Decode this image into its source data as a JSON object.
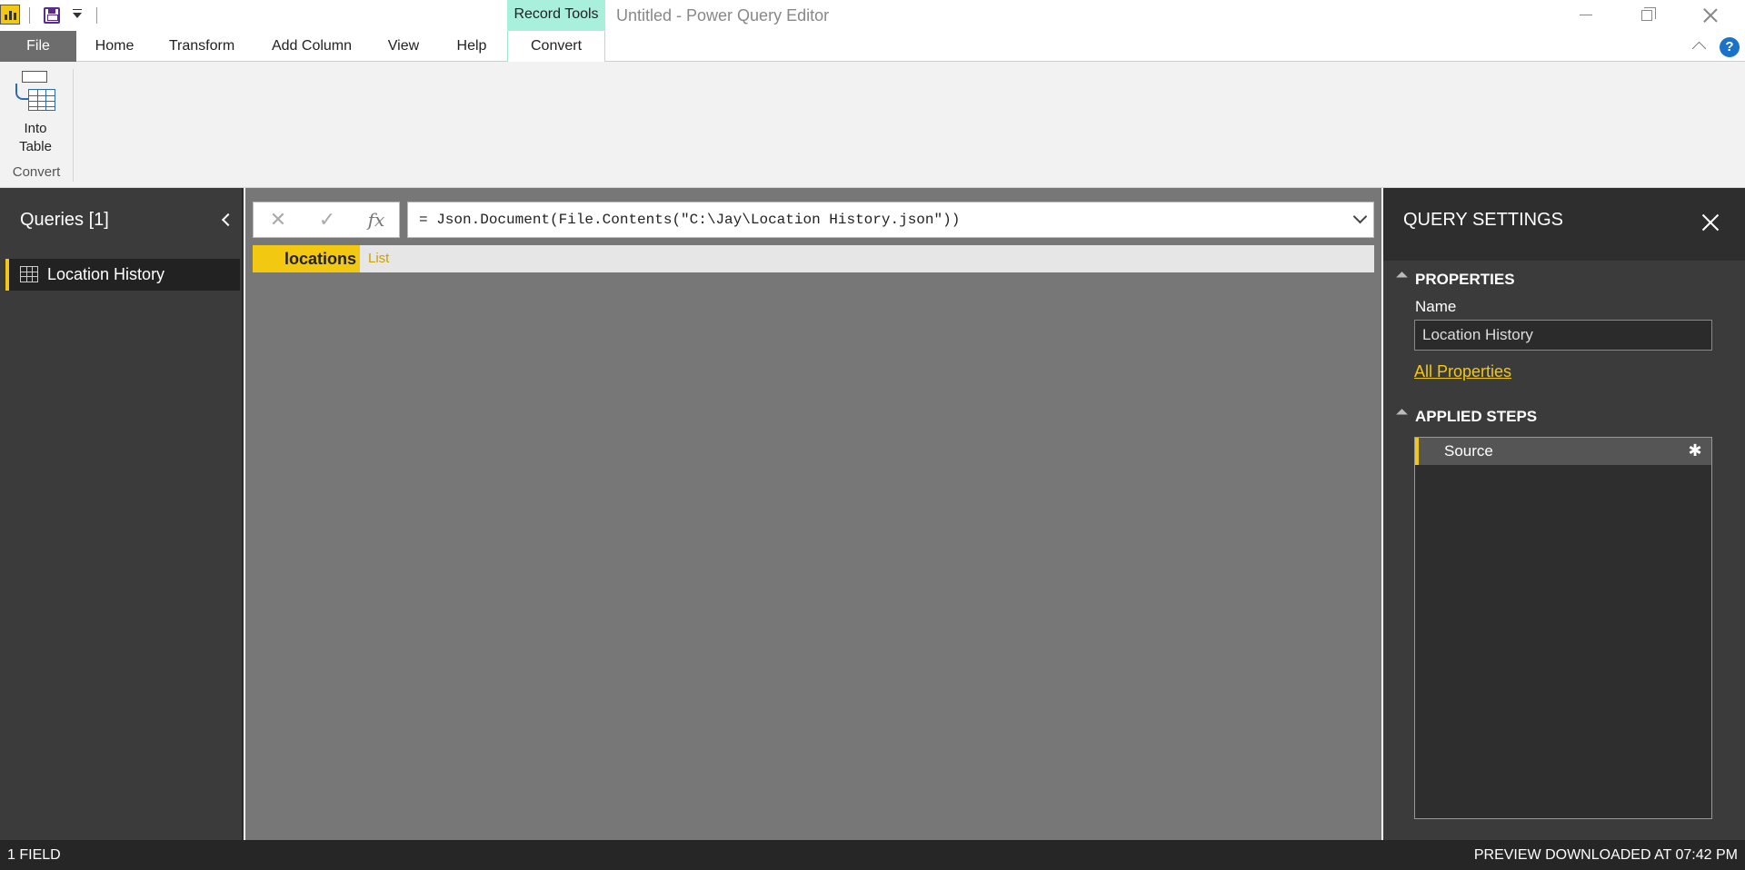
{
  "window": {
    "context_group": "Record Tools",
    "title": "Untitled - Power Query Editor"
  },
  "tabs": [
    {
      "label": "File"
    },
    {
      "label": "Home"
    },
    {
      "label": "Transform"
    },
    {
      "label": "Add Column"
    },
    {
      "label": "View"
    },
    {
      "label": "Help"
    },
    {
      "label": "Convert"
    }
  ],
  "ribbon": {
    "into_table_label_1": "Into",
    "into_table_label_2": "Table",
    "group_label": "Convert"
  },
  "help_icon": "?",
  "queries": {
    "title": "Queries [1]",
    "items": [
      {
        "label": "Location History"
      }
    ]
  },
  "formula_bar": {
    "cancel_icon": "✕",
    "commit_icon": "✓",
    "fx_icon": "fx",
    "formula": "= Json.Document(File.Contents(\"C:\\Jay\\Location History.json\"))"
  },
  "record": {
    "field": "locations",
    "value": "List"
  },
  "query_settings": {
    "title": "QUERY SETTINGS",
    "properties_title": "PROPERTIES",
    "name_label": "Name",
    "name_value": "Location History",
    "all_properties": "All Properties",
    "applied_steps_title": "APPLIED STEPS",
    "steps": [
      {
        "label": "Source"
      }
    ],
    "gear_icon": "✱"
  },
  "status": {
    "left": "1 FIELD",
    "right": "PREVIEW DOWNLOADED AT 07:42 PM"
  },
  "colors": {
    "accent": "#f2c811",
    "context_tab": "#a8efdc",
    "pane_dark": "#3b3b3b",
    "preview_bg": "#777777"
  }
}
